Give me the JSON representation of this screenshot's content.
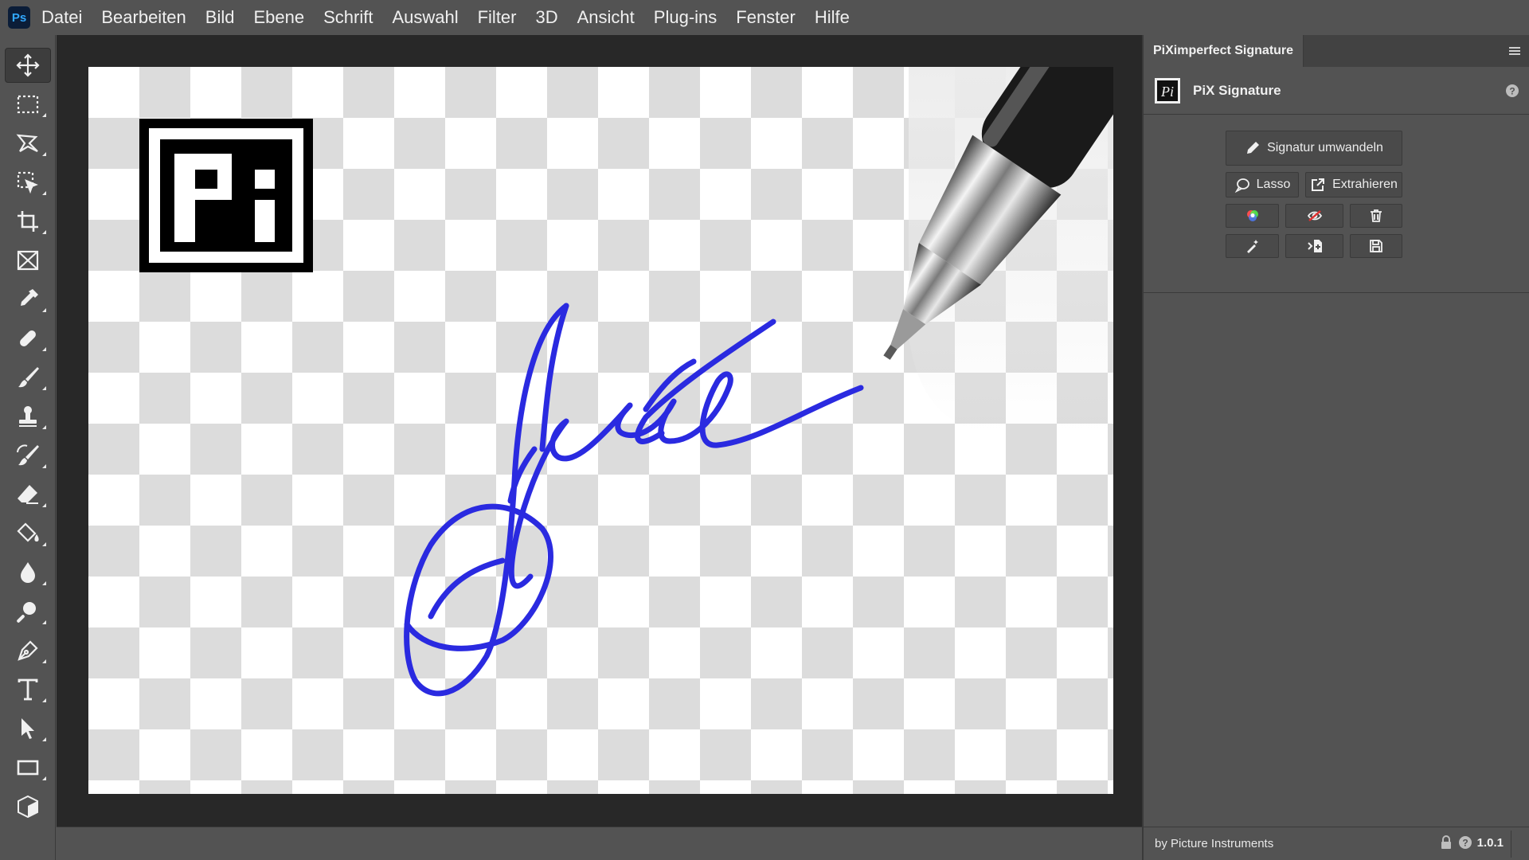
{
  "app": {
    "logo_text": "Ps",
    "menu": [
      "Datei",
      "Bearbeiten",
      "Bild",
      "Ebene",
      "Schrift",
      "Auswahl",
      "Filter",
      "3D",
      "Ansicht",
      "Plug-ins",
      "Fenster",
      "Hilfe"
    ]
  },
  "tools": [
    {
      "icon": "move-icon",
      "active": true
    },
    {
      "icon": "rectangular-marquee-icon"
    },
    {
      "icon": "lasso-icon"
    },
    {
      "icon": "object-selection-icon"
    },
    {
      "icon": "crop-icon"
    },
    {
      "icon": "frame-icon"
    },
    {
      "icon": "eyedropper-icon"
    },
    {
      "icon": "healing-brush-icon"
    },
    {
      "icon": "brush-icon"
    },
    {
      "icon": "clone-stamp-icon"
    },
    {
      "icon": "history-brush-icon"
    },
    {
      "icon": "eraser-icon"
    },
    {
      "icon": "paint-bucket-icon"
    },
    {
      "icon": "blur-icon"
    },
    {
      "icon": "dodge-icon"
    },
    {
      "icon": "pen-icon"
    },
    {
      "icon": "type-icon"
    },
    {
      "icon": "path-selection-icon"
    },
    {
      "icon": "rectangle-shape-icon"
    },
    {
      "icon": "3d-object-icon"
    }
  ],
  "canvas": {
    "logo_icon": "pi-logo",
    "signature_text": "Signature",
    "ink_color": "#2a2ae0"
  },
  "panel": {
    "tab_title": "PiXimperfect Signature",
    "header_title": "PiX Signature",
    "buttons": {
      "convert": "Signatur umwandeln",
      "lasso": "Lasso",
      "extract": "Extrahieren"
    },
    "icon_buttons": [
      "color-wheel-icon",
      "hide-eye-icon",
      "trash-icon",
      "magic-wand-icon",
      "import-icon",
      "save-icon"
    ],
    "footer": {
      "by": "by Picture Instruments",
      "version": "1.0.1"
    }
  }
}
